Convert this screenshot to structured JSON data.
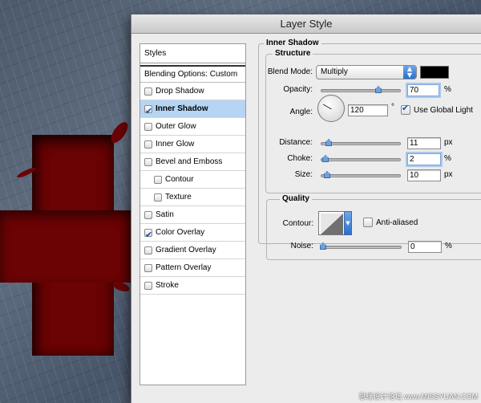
{
  "window": {
    "title": "Layer Style"
  },
  "styles_list": {
    "header": "Styles",
    "blending_options": "Blending Options: Custom",
    "items": [
      {
        "label": "Drop Shadow",
        "checked": false,
        "selected": false,
        "sub": false
      },
      {
        "label": "Inner Shadow",
        "checked": true,
        "selected": true,
        "sub": false
      },
      {
        "label": "Outer Glow",
        "checked": false,
        "selected": false,
        "sub": false
      },
      {
        "label": "Inner Glow",
        "checked": false,
        "selected": false,
        "sub": false
      },
      {
        "label": "Bevel and Emboss",
        "checked": false,
        "selected": false,
        "sub": false
      },
      {
        "label": "Contour",
        "checked": false,
        "selected": false,
        "sub": true
      },
      {
        "label": "Texture",
        "checked": false,
        "selected": false,
        "sub": true
      },
      {
        "label": "Satin",
        "checked": false,
        "selected": false,
        "sub": false
      },
      {
        "label": "Color Overlay",
        "checked": true,
        "selected": false,
        "sub": false
      },
      {
        "label": "Gradient Overlay",
        "checked": false,
        "selected": false,
        "sub": false
      },
      {
        "label": "Pattern Overlay",
        "checked": false,
        "selected": false,
        "sub": false
      },
      {
        "label": "Stroke",
        "checked": false,
        "selected": false,
        "sub": false
      }
    ]
  },
  "inner_shadow": {
    "title": "Inner Shadow",
    "structure": {
      "title": "Structure",
      "blend_mode_label": "Blend Mode:",
      "blend_mode_value": "Multiply",
      "shadow_color": "#000000",
      "opacity_label": "Opacity:",
      "opacity_value": "70",
      "opacity_unit": "%",
      "angle_label": "Angle:",
      "angle_value": "120",
      "angle_unit": "°",
      "global_light_label": "Use Global Light",
      "global_light_checked": true,
      "distance_label": "Distance:",
      "distance_value": "11",
      "distance_unit": "px",
      "choke_label": "Choke:",
      "choke_value": "2",
      "choke_unit": "%",
      "size_label": "Size:",
      "size_value": "10",
      "size_unit": "px"
    },
    "quality": {
      "title": "Quality",
      "contour_label": "Contour:",
      "anti_aliased_label": "Anti-aliased",
      "anti_aliased_checked": false,
      "noise_label": "Noise:",
      "noise_value": "0",
      "noise_unit": "%"
    }
  },
  "watermark": "思缘设计论坛 www.MISSYUAN.COM"
}
